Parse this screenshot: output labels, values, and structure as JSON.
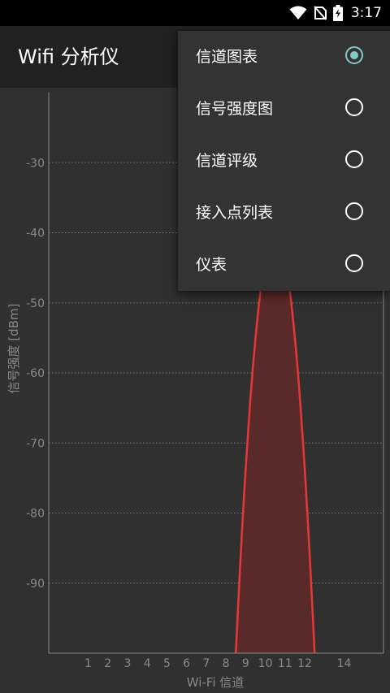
{
  "status_bar": {
    "time": "3:17",
    "icons": [
      "wifi-icon",
      "no-sim-icon",
      "battery-charging-icon"
    ]
  },
  "app_bar": {
    "title": "Wifi 分析仪"
  },
  "menu": {
    "items": [
      {
        "label": "信道图表",
        "selected": true
      },
      {
        "label": "信号强度图",
        "selected": false
      },
      {
        "label": "信道评级",
        "selected": false
      },
      {
        "label": "接入点列表",
        "selected": false
      },
      {
        "label": "仪表",
        "selected": false
      }
    ]
  },
  "colors": {
    "background": "#303030",
    "app_bar": "#212121",
    "menu_bg": "#333333",
    "accent": "#80cbc4",
    "signal_line": "#e53935",
    "signal_fill": "#5a2a2a",
    "axis_text": "#8a8a8a"
  },
  "chart_data": {
    "type": "area",
    "xlabel": "Wi-Fi 信道",
    "ylabel": "信号强度 [dBm]",
    "x_ticks": [
      "1",
      "2",
      "3",
      "4",
      "5",
      "6",
      "7",
      "8",
      "9",
      "10",
      "11",
      "12",
      "14"
    ],
    "y_ticks": [
      "-30",
      "-40",
      "-50",
      "-60",
      "-70",
      "-80",
      "-90"
    ],
    "xlim": [
      -1,
      16
    ],
    "ylim": [
      -100,
      -20
    ],
    "grid": true,
    "series": [
      {
        "center_channel": 10.5,
        "start_channel": 8.5,
        "end_channel": 12.5,
        "peak_dbm": -40,
        "floor_dbm": -100
      }
    ]
  }
}
